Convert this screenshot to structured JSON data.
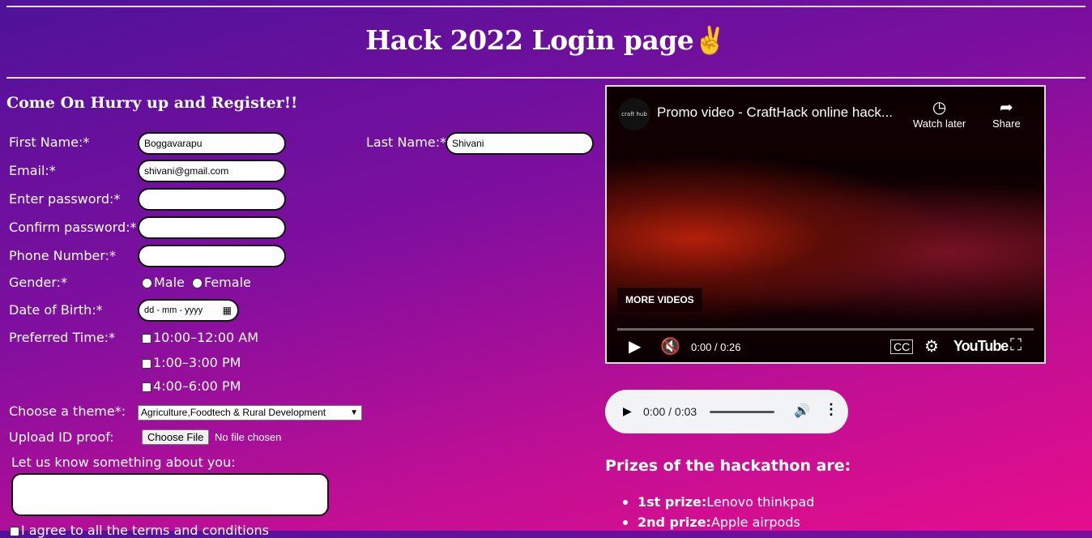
{
  "header": {
    "title": "Hack 2022 Login page✌️"
  },
  "form": {
    "heading": "Come On Hurry up and Register!!",
    "first_name_label": "First Name:*",
    "first_name_value": "Boggavarapu",
    "last_name_label": "Last Name:*",
    "last_name_value": "Shivani",
    "email_label": "Email:*",
    "email_value": "shivani@gmail.com",
    "password_label": "Enter password:*",
    "confirm_label": "Confirm password:*",
    "phone_label": "Phone Number:*",
    "gender_label": "Gender:*",
    "gender_options": [
      "Male",
      "Female"
    ],
    "dob_label": "Date of Birth:*",
    "dob_placeholder": "dd - mm - yyyy",
    "time_label": "Preferred Time:*",
    "time_options": [
      "10:00–12:00 AM",
      "1:00–3:00 PM",
      "4:00–6:00 PM"
    ],
    "theme_label": "Choose a theme*:",
    "theme_value": "Agriculture,Foodtech & Rural Development",
    "upload_label": "Upload ID proof:",
    "upload_button": "Choose File",
    "upload_status": "No file chosen",
    "about_label": "Let us know something about you:",
    "terms_label": "I agree to all the terms and conditions"
  },
  "video": {
    "channel": "craft hub",
    "title": "Promo video - CraftHack online hack...",
    "watch_later": "Watch later",
    "share": "Share",
    "more_videos": "MORE VIDEOS",
    "time": "0:00 / 0:26",
    "brand": "YouTube"
  },
  "audio": {
    "time": "0:00 / 0:03"
  },
  "prizes": {
    "title": "Prizes of the hackathon are:",
    "items": [
      {
        "rank": "1st prize:",
        "name": "Lenovo thinkpad"
      },
      {
        "rank": "2nd prize:",
        "name": "Apple airpods"
      }
    ]
  }
}
